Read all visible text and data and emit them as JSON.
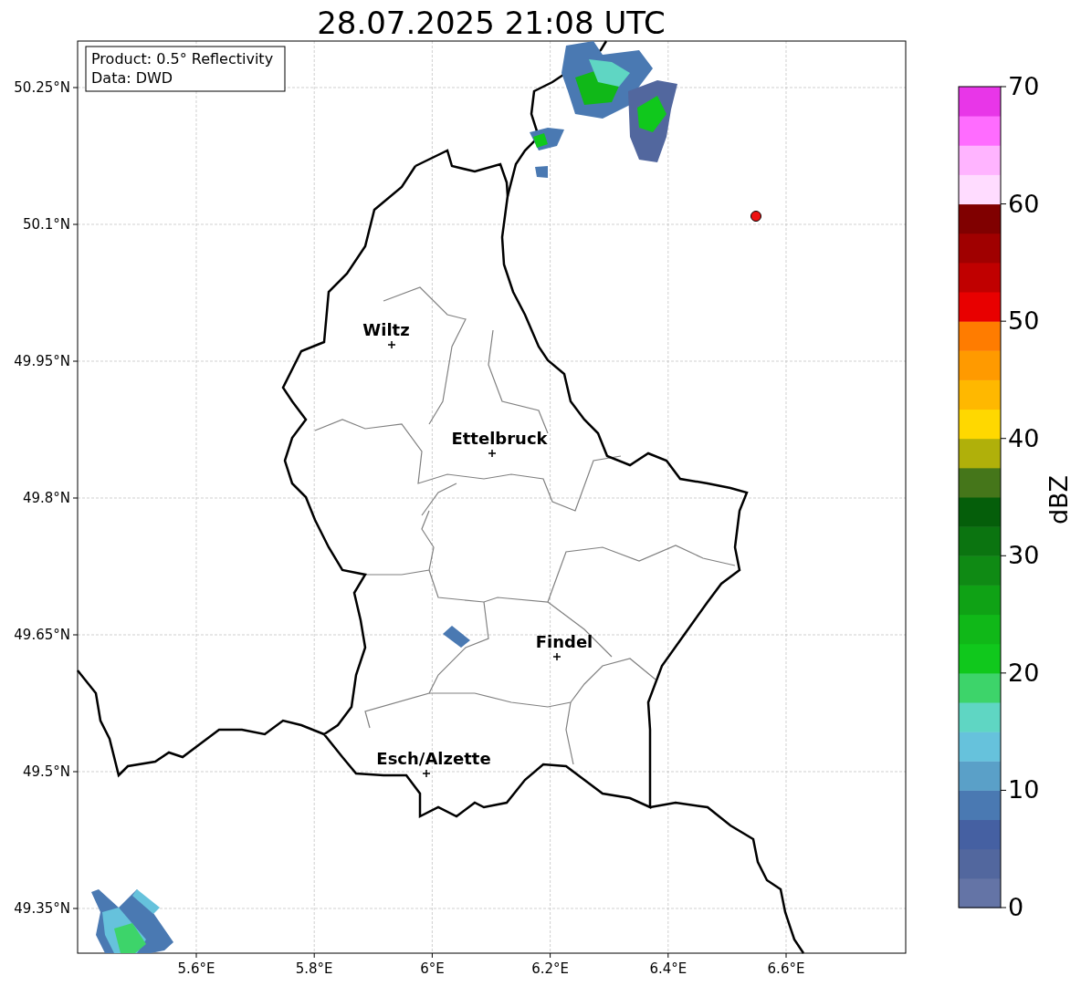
{
  "title": "28.07.2025 21:08 UTC",
  "map": {
    "info_box": [
      "Product: 0.5° Reflectivity",
      "Data: DWD"
    ],
    "xticks": [
      "5.6°E",
      "5.8°E",
      "6°E",
      "6.2°E",
      "6.4°E",
      "6.6°E"
    ],
    "yticks": [
      "50.25°N",
      "50.1°N",
      "49.95°N",
      "49.8°N",
      "49.65°N",
      "49.5°N",
      "49.35°N"
    ],
    "cities": [
      {
        "name": "Wiltz"
      },
      {
        "name": "Ettelbruck"
      },
      {
        "name": "Findel"
      },
      {
        "name": "Esch/Alzette"
      }
    ]
  },
  "colorbar": {
    "label": "dBZ",
    "ticks": [
      "70",
      "60",
      "50",
      "40",
      "30",
      "20",
      "10",
      "0"
    ]
  }
}
